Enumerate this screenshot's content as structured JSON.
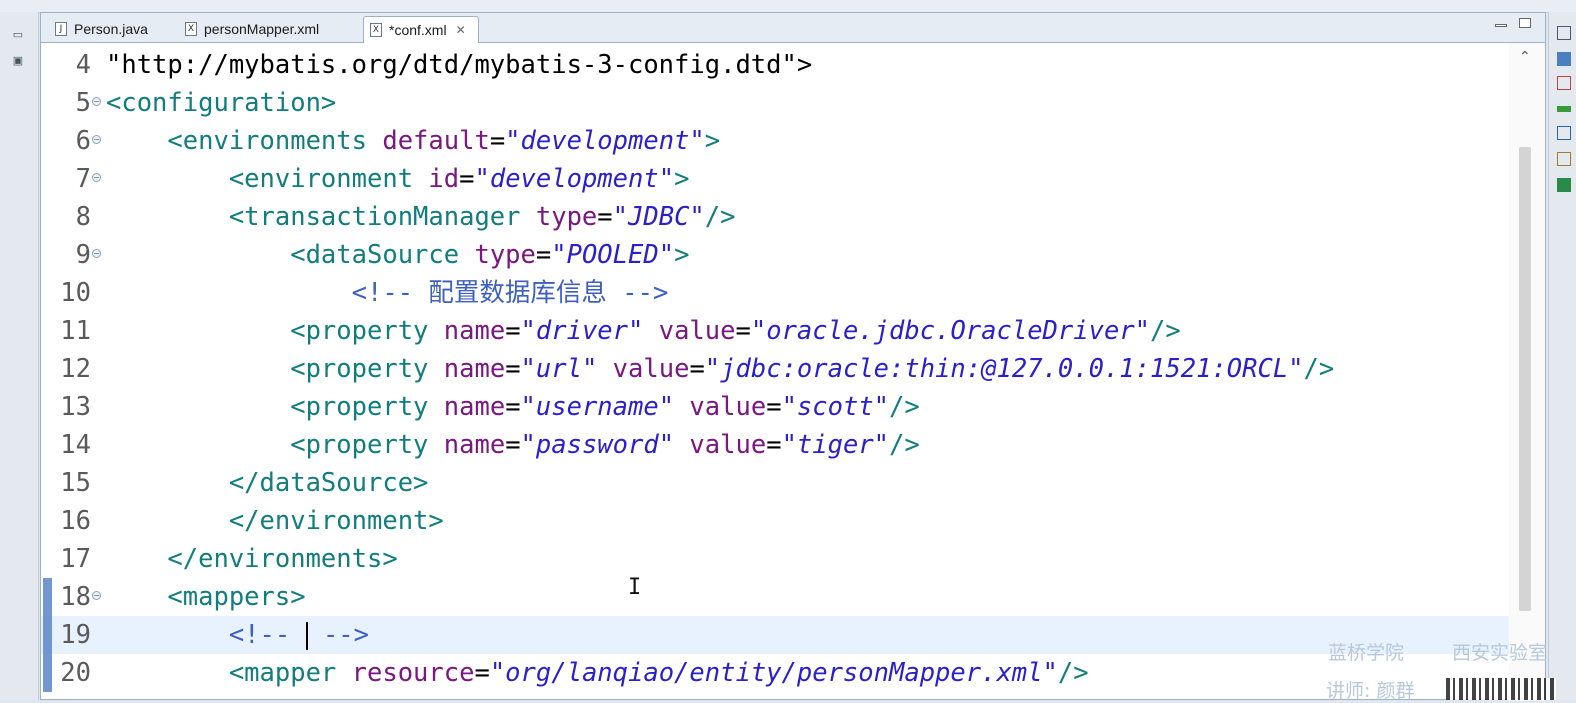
{
  "tabs": [
    {
      "icon": "J",
      "label": "Person.java",
      "active": false
    },
    {
      "icon": "X",
      "label": "personMapper.xml",
      "active": false
    },
    {
      "icon": "X",
      "label": "*conf.xml",
      "active": true,
      "close": "✕"
    }
  ],
  "editor": {
    "current_line": "19",
    "lines": [
      {
        "n": "4",
        "fold": false,
        "seg": [
          {
            "t": "\"http://mybatis.org/dtd/mybatis-3-config.dtd\">",
            "c": "plain"
          }
        ]
      },
      {
        "n": "5",
        "fold": true,
        "seg": [
          {
            "t": "<configuration>",
            "c": "tag"
          }
        ]
      },
      {
        "n": "6",
        "fold": true,
        "seg": [
          {
            "t": "    <environments ",
            "c": "tag"
          },
          {
            "t": "default",
            "c": "attr"
          },
          {
            "t": "=",
            "c": "plain"
          },
          {
            "t": "\"development\"",
            "c": "val"
          },
          {
            "t": ">",
            "c": "tag"
          }
        ]
      },
      {
        "n": "7",
        "fold": true,
        "seg": [
          {
            "t": "        <environment ",
            "c": "tag"
          },
          {
            "t": "id",
            "c": "attr"
          },
          {
            "t": "=",
            "c": "plain"
          },
          {
            "t": "\"development\"",
            "c": "val"
          },
          {
            "t": ">",
            "c": "tag"
          }
        ]
      },
      {
        "n": "8",
        "fold": false,
        "seg": [
          {
            "t": "        <transactionManager ",
            "c": "tag"
          },
          {
            "t": "type",
            "c": "attr"
          },
          {
            "t": "=",
            "c": "plain"
          },
          {
            "t": "\"JDBC\"",
            "c": "val"
          },
          {
            "t": "/>",
            "c": "tag"
          }
        ]
      },
      {
        "n": "9",
        "fold": true,
        "seg": [
          {
            "t": "            <dataSource ",
            "c": "tag"
          },
          {
            "t": "type",
            "c": "attr"
          },
          {
            "t": "=",
            "c": "plain"
          },
          {
            "t": "\"POOLED\"",
            "c": "val"
          },
          {
            "t": ">",
            "c": "tag"
          }
        ]
      },
      {
        "n": "10",
        "fold": false,
        "seg": [
          {
            "t": "                <!-- 配置数据库信息 -->",
            "c": "cmt"
          }
        ]
      },
      {
        "n": "11",
        "fold": false,
        "seg": [
          {
            "t": "            <property ",
            "c": "tag"
          },
          {
            "t": "name",
            "c": "attr"
          },
          {
            "t": "=",
            "c": "plain"
          },
          {
            "t": "\"driver\"",
            "c": "val"
          },
          {
            "t": " value",
            "c": "attr"
          },
          {
            "t": "=",
            "c": "plain"
          },
          {
            "t": "\"oracle.jdbc.OracleDriver\"",
            "c": "val"
          },
          {
            "t": "/>",
            "c": "tag"
          }
        ]
      },
      {
        "n": "12",
        "fold": false,
        "seg": [
          {
            "t": "            <property ",
            "c": "tag"
          },
          {
            "t": "name",
            "c": "attr"
          },
          {
            "t": "=",
            "c": "plain"
          },
          {
            "t": "\"url\"",
            "c": "val"
          },
          {
            "t": " value",
            "c": "attr"
          },
          {
            "t": "=",
            "c": "plain"
          },
          {
            "t": "\"jdbc:oracle:thin:@127.0.0.1:1521:ORCL\"",
            "c": "val"
          },
          {
            "t": "/>",
            "c": "tag"
          }
        ]
      },
      {
        "n": "13",
        "fold": false,
        "seg": [
          {
            "t": "            <property ",
            "c": "tag"
          },
          {
            "t": "name",
            "c": "attr"
          },
          {
            "t": "=",
            "c": "plain"
          },
          {
            "t": "\"username\"",
            "c": "val"
          },
          {
            "t": " value",
            "c": "attr"
          },
          {
            "t": "=",
            "c": "plain"
          },
          {
            "t": "\"scott\"",
            "c": "val"
          },
          {
            "t": "/>",
            "c": "tag"
          }
        ]
      },
      {
        "n": "14",
        "fold": false,
        "seg": [
          {
            "t": "            <property ",
            "c": "tag"
          },
          {
            "t": "name",
            "c": "attr"
          },
          {
            "t": "=",
            "c": "plain"
          },
          {
            "t": "\"password\"",
            "c": "val"
          },
          {
            "t": " value",
            "c": "attr"
          },
          {
            "t": "=",
            "c": "plain"
          },
          {
            "t": "\"tiger\"",
            "c": "val"
          },
          {
            "t": "/>",
            "c": "tag"
          }
        ]
      },
      {
        "n": "15",
        "fold": false,
        "seg": [
          {
            "t": "        </dataSource>",
            "c": "tag"
          }
        ]
      },
      {
        "n": "16",
        "fold": false,
        "seg": [
          {
            "t": "        </environment>",
            "c": "tag"
          }
        ]
      },
      {
        "n": "17",
        "fold": false,
        "seg": [
          {
            "t": "    </environments>",
            "c": "tag"
          }
        ]
      },
      {
        "n": "18",
        "fold": true,
        "seg": [
          {
            "t": "    <mappers>",
            "c": "tag"
          }
        ]
      },
      {
        "n": "19",
        "fold": false,
        "seg": [
          {
            "t": "        <!-- ",
            "c": "cmt"
          },
          {
            "t": "",
            "c": "caret"
          },
          {
            "t": " -->",
            "c": "cmt"
          }
        ]
      },
      {
        "n": "20",
        "fold": false,
        "seg": [
          {
            "t": "        <mapper ",
            "c": "tag"
          },
          {
            "t": "resource",
            "c": "attr"
          },
          {
            "t": "=",
            "c": "plain"
          },
          {
            "t": "\"org/lanqiao/entity/personMapper.xml\"",
            "c": "val"
          },
          {
            "t": "/>",
            "c": "tag"
          }
        ]
      }
    ]
  },
  "watermarks": [
    "蓝桥学院",
    "西安实验室",
    "讲师: 颜群"
  ],
  "colors": {
    "tag": "#127d7d",
    "attr": "#7a1780",
    "value": "#2a1fcc",
    "comment": "#3d5fbf",
    "current_line": "#e8f2fe"
  }
}
